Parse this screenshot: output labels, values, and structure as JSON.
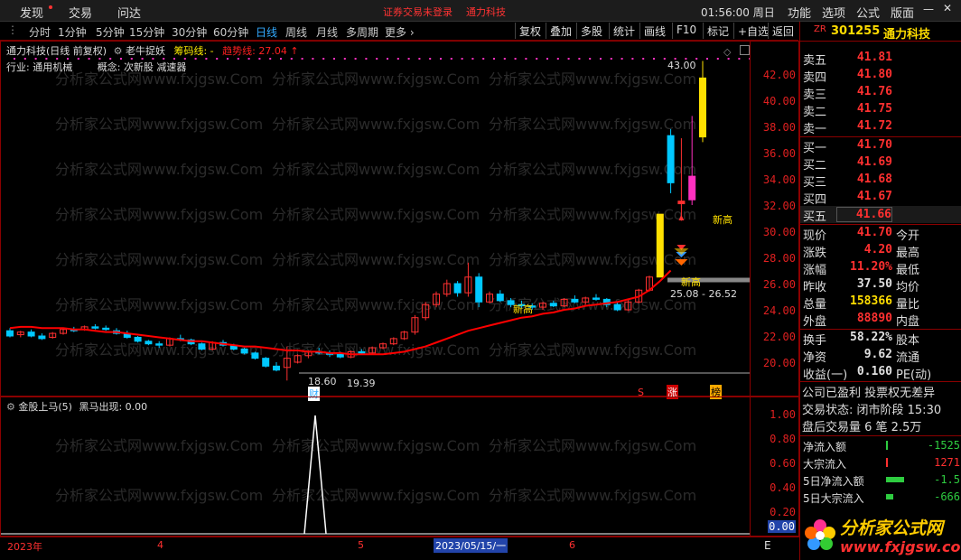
{
  "topmenu": {
    "items": [
      "发现",
      "交易",
      "问达"
    ],
    "notice": "证券交易未登录",
    "stock_name": "通力科技",
    "time": "01:56:00",
    "weekday": "周日",
    "right_items": [
      "功能",
      "选项",
      "公式",
      "版面"
    ]
  },
  "toolbar": {
    "periods": [
      "分时",
      "1分钟",
      "5分钟",
      "15分钟",
      "30分钟",
      "60分钟",
      "日线",
      "周线",
      "月线",
      "多周期",
      "更多"
    ],
    "active_period": "日线",
    "buttons": [
      "复权",
      "叠加",
      "多股",
      "统计",
      "画线",
      "F10",
      "标记",
      "+自选",
      "返回"
    ]
  },
  "main_chart": {
    "title": "通力科技(日线 前复权)",
    "indicator": "老牛捉妖",
    "indicator_line1": "筹码线: -",
    "indicator_line2": "趋势线: 27.04",
    "industry_label": "行业:",
    "industry": "通用机械",
    "concept_label": "概念:",
    "concepts": "次新股 减速器",
    "price_axis": [
      "42.00",
      "40.00",
      "38.00",
      "36.00",
      "34.00",
      "32.00",
      "30.00",
      "28.00",
      "26.00",
      "24.00",
      "22.00",
      "20.00"
    ],
    "annotations": {
      "high_price": "43.00",
      "low_price": "18.60",
      "low_price2": "19.39",
      "box_range": "25.08 - 26.52",
      "new_high": "新高",
      "markers": [
        "财",
        "S",
        "涨",
        "榜"
      ]
    }
  },
  "chart_data": {
    "type": "candlestick",
    "title": "通力科技(日线 前复权)",
    "ylim": [
      19,
      43
    ],
    "candles": [
      {
        "o": 22.4,
        "h": 22.6,
        "l": 21.9,
        "c": 22.0
      },
      {
        "o": 22.1,
        "h": 22.4,
        "l": 21.9,
        "c": 22.3
      },
      {
        "o": 22.3,
        "h": 22.5,
        "l": 21.9,
        "c": 22.0
      },
      {
        "o": 22.0,
        "h": 22.2,
        "l": 21.7,
        "c": 21.8
      },
      {
        "o": 21.9,
        "h": 22.3,
        "l": 21.8,
        "c": 22.2
      },
      {
        "o": 22.2,
        "h": 22.6,
        "l": 22.1,
        "c": 22.5
      },
      {
        "o": 22.5,
        "h": 22.7,
        "l": 22.3,
        "c": 22.4
      },
      {
        "o": 22.5,
        "h": 22.8,
        "l": 22.4,
        "c": 22.7
      },
      {
        "o": 22.7,
        "h": 22.9,
        "l": 22.5,
        "c": 22.6
      },
      {
        "o": 22.6,
        "h": 22.8,
        "l": 22.4,
        "c": 22.5
      },
      {
        "o": 22.4,
        "h": 22.6,
        "l": 22.1,
        "c": 22.2
      },
      {
        "o": 22.2,
        "h": 22.4,
        "l": 21.8,
        "c": 21.9
      },
      {
        "o": 21.9,
        "h": 22.0,
        "l": 21.5,
        "c": 21.6
      },
      {
        "o": 21.6,
        "h": 21.7,
        "l": 21.3,
        "c": 21.4
      },
      {
        "o": 21.4,
        "h": 21.6,
        "l": 21.1,
        "c": 21.3
      },
      {
        "o": 21.3,
        "h": 21.9,
        "l": 21.2,
        "c": 21.8
      },
      {
        "o": 21.8,
        "h": 22.1,
        "l": 21.6,
        "c": 21.7
      },
      {
        "o": 21.7,
        "h": 21.8,
        "l": 21.3,
        "c": 21.4
      },
      {
        "o": 21.4,
        "h": 21.5,
        "l": 20.9,
        "c": 21.0
      },
      {
        "o": 21.0,
        "h": 21.6,
        "l": 20.9,
        "c": 21.5
      },
      {
        "o": 21.5,
        "h": 21.7,
        "l": 21.2,
        "c": 21.3
      },
      {
        "o": 21.3,
        "h": 21.4,
        "l": 20.9,
        "c": 21.0
      },
      {
        "o": 21.0,
        "h": 21.1,
        "l": 20.6,
        "c": 20.7
      },
      {
        "o": 20.7,
        "h": 20.8,
        "l": 20.2,
        "c": 20.3
      },
      {
        "o": 20.3,
        "h": 20.4,
        "l": 19.6,
        "c": 19.7
      },
      {
        "o": 19.7,
        "h": 20.0,
        "l": 19.3,
        "c": 19.4
      },
      {
        "o": 19.6,
        "h": 21.2,
        "l": 18.6,
        "c": 20.3
      },
      {
        "o": 20.0,
        "h": 20.6,
        "l": 19.9,
        "c": 20.5
      },
      {
        "o": 20.5,
        "h": 20.9,
        "l": 20.3,
        "c": 20.8
      },
      {
        "o": 20.8,
        "h": 21.1,
        "l": 20.6,
        "c": 20.7
      },
      {
        "o": 20.7,
        "h": 20.9,
        "l": 20.4,
        "c": 20.6
      },
      {
        "o": 20.6,
        "h": 20.8,
        "l": 20.3,
        "c": 20.4
      },
      {
        "o": 20.4,
        "h": 20.9,
        "l": 20.3,
        "c": 20.8
      },
      {
        "o": 20.8,
        "h": 21.0,
        "l": 20.6,
        "c": 20.7
      },
      {
        "o": 20.7,
        "h": 21.2,
        "l": 20.6,
        "c": 21.1
      },
      {
        "o": 21.1,
        "h": 21.5,
        "l": 21.0,
        "c": 21.4
      },
      {
        "o": 21.4,
        "h": 21.9,
        "l": 21.3,
        "c": 21.8
      },
      {
        "o": 21.8,
        "h": 22.4,
        "l": 21.7,
        "c": 22.3
      },
      {
        "o": 22.3,
        "h": 23.6,
        "l": 22.1,
        "c": 23.4
      },
      {
        "o": 23.4,
        "h": 24.6,
        "l": 23.2,
        "c": 24.4
      },
      {
        "o": 24.4,
        "h": 25.4,
        "l": 24.2,
        "c": 25.2
      },
      {
        "o": 25.2,
        "h": 26.3,
        "l": 25.0,
        "c": 26.0
      },
      {
        "o": 26.0,
        "h": 26.2,
        "l": 25.0,
        "c": 25.3
      },
      {
        "o": 25.3,
        "h": 27.6,
        "l": 25.0,
        "c": 26.5
      },
      {
        "o": 26.5,
        "h": 26.8,
        "l": 24.2,
        "c": 24.6
      },
      {
        "o": 24.6,
        "h": 25.4,
        "l": 24.5,
        "c": 25.2
      },
      {
        "o": 25.2,
        "h": 25.5,
        "l": 24.6,
        "c": 24.7
      },
      {
        "o": 24.7,
        "h": 24.9,
        "l": 24.2,
        "c": 24.4
      },
      {
        "o": 24.4,
        "h": 24.7,
        "l": 24.1,
        "c": 24.3
      },
      {
        "o": 24.3,
        "h": 24.5,
        "l": 24.0,
        "c": 24.2
      },
      {
        "o": 24.2,
        "h": 24.6,
        "l": 24.0,
        "c": 24.5
      },
      {
        "o": 24.5,
        "h": 24.7,
        "l": 24.2,
        "c": 24.3
      },
      {
        "o": 24.3,
        "h": 24.9,
        "l": 24.2,
        "c": 24.8
      },
      {
        "o": 24.8,
        "h": 25.1,
        "l": 24.5,
        "c": 24.6
      },
      {
        "o": 24.6,
        "h": 25.0,
        "l": 24.4,
        "c": 24.9
      },
      {
        "o": 24.9,
        "h": 25.2,
        "l": 24.7,
        "c": 24.8
      },
      {
        "o": 24.8,
        "h": 24.9,
        "l": 24.2,
        "c": 24.4
      },
      {
        "o": 24.4,
        "h": 24.6,
        "l": 23.9,
        "c": 24.0
      },
      {
        "o": 24.0,
        "h": 24.8,
        "l": 23.9,
        "c": 24.6
      },
      {
        "o": 24.6,
        "h": 25.6,
        "l": 24.5,
        "c": 25.5
      },
      {
        "o": 25.5,
        "h": 26.6,
        "l": 25.4,
        "c": 26.5
      },
      {
        "o": 26.5,
        "h": 31.3,
        "l": 26.5,
        "c": 31.3
      },
      {
        "o": 33.7,
        "h": 37.8,
        "l": 32.9,
        "c": 37.3
      },
      {
        "o": 32.1,
        "h": 37.1,
        "l": 30.8,
        "c": 32.3
      },
      {
        "o": 34.2,
        "h": 38.8,
        "l": 32.0,
        "c": 32.4
      },
      {
        "o": 37.2,
        "h": 43.0,
        "l": 36.8,
        "c": 41.7
      }
    ],
    "trend_line": [
      22.6,
      22.7,
      22.7,
      22.6,
      22.6,
      22.6,
      22.5,
      22.5,
      22.4,
      22.3,
      22.3,
      22.2,
      22.1,
      22.0,
      21.9,
      21.8,
      21.7,
      21.6,
      21.6,
      21.5,
      21.4,
      21.3,
      21.2,
      21.2,
      21.1,
      21.0,
      20.9,
      20.9,
      20.8,
      20.8,
      20.7,
      20.7,
      20.6,
      20.6,
      20.6,
      20.6,
      20.7,
      20.8,
      21.0,
      21.2,
      21.5,
      21.8,
      22.1,
      22.4,
      22.6,
      22.8,
      23.0,
      23.2,
      23.4,
      23.5,
      23.7,
      23.8,
      24.0,
      24.1,
      24.3,
      24.4,
      24.5,
      24.6,
      24.8,
      25.0,
      25.5,
      26.2,
      27.0
    ]
  },
  "sub_chart": {
    "title": "金股上马(5)",
    "indicator": "黑马出现: 0.00",
    "axis": [
      "1.00",
      "0.80",
      "0.60",
      "0.40",
      "0.20",
      "0.00"
    ],
    "signal_value": 1.0
  },
  "time_axis": {
    "labels": [
      "2023年",
      "4",
      "5",
      "2023/05/15/一",
      "6"
    ],
    "right_cap": "E"
  },
  "quote": {
    "code": "301255",
    "name": "通力科技",
    "zr": "ZR",
    "asks": [
      {
        "label": "卖五",
        "price": "41.81"
      },
      {
        "label": "卖四",
        "price": "41.80"
      },
      {
        "label": "卖三",
        "price": "41.76"
      },
      {
        "label": "卖二",
        "price": "41.75"
      },
      {
        "label": "卖一",
        "price": "41.72"
      }
    ],
    "bids": [
      {
        "label": "买一",
        "price": "41.70"
      },
      {
        "label": "买二",
        "price": "41.69"
      },
      {
        "label": "买三",
        "price": "41.68"
      },
      {
        "label": "买四",
        "price": "41.67"
      },
      {
        "label": "买五",
        "price": "41.66"
      }
    ],
    "stats": [
      {
        "l1": "现价",
        "v": "41.70",
        "l2": "今开",
        "color": "#ff3030"
      },
      {
        "l1": "涨跌",
        "v": "4.20",
        "l2": "最高",
        "color": "#ff3030"
      },
      {
        "l1": "涨幅",
        "v": "11.20%",
        "l2": "最低",
        "color": "#ff3030"
      },
      {
        "l1": "昨收",
        "v": "37.50",
        "l2": "均价",
        "color": "#e0e0e0"
      },
      {
        "l1": "总量",
        "v": "158366",
        "l2": "量比",
        "color": "#ffdd00"
      },
      {
        "l1": "外盘",
        "v": "88890",
        "l2": "内盘",
        "color": "#ff3030"
      }
    ],
    "stats2": [
      {
        "l1": "换手",
        "v": "58.22%",
        "l2": "股本",
        "color": "#e0e0e0"
      },
      {
        "l1": "净资",
        "v": "9.62",
        "l2": "流通",
        "color": "#e0e0e0"
      },
      {
        "l1": "收益(一)",
        "v": "0.160",
        "l2": "PE(动)",
        "color": "#e0e0e0"
      }
    ],
    "company_note": "公司已盈利 投票权无差异",
    "trade_status": "交易状态: 闭市阶段 15:30",
    "after_hours": "盘后交易量 6 笔 2.5万",
    "flows": [
      {
        "label": "净流入额",
        "value": "-1525",
        "bar": 0
      },
      {
        "label": "大宗流入",
        "value": "1271",
        "bar": 0
      },
      {
        "label": "5日净流入额",
        "value": "-1.5",
        "bar": 20
      },
      {
        "label": "5日大宗流入",
        "value": "-666",
        "bar": 8
      }
    ]
  },
  "logo": {
    "text": "分析家公式网",
    "url_text": "www.fxjgsw.com"
  },
  "watermark": "分析家公式网www.fxjgsw.Com",
  "colors": {
    "up": "#ff3030",
    "down": "#00c8ff",
    "trend": "#ff0000",
    "yellow": "#ffe000",
    "magenta": "#ff30c0"
  }
}
